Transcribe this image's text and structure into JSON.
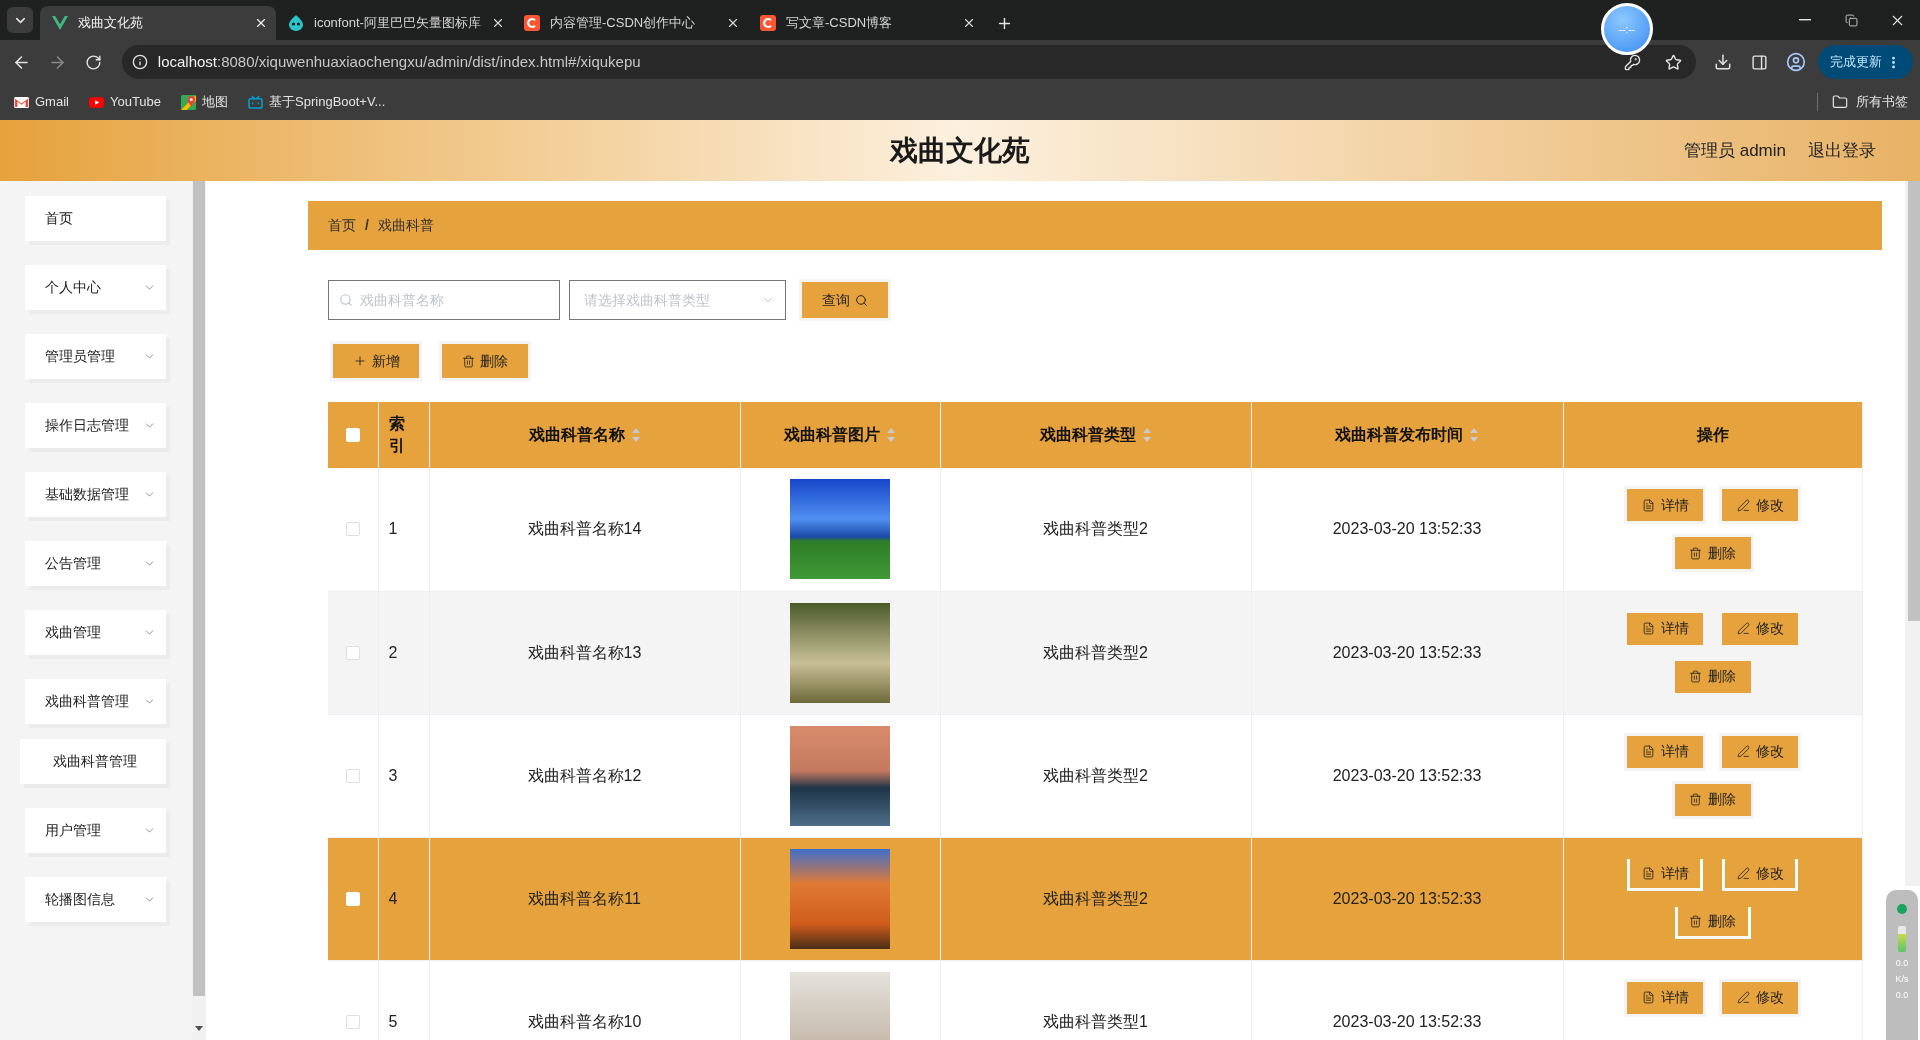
{
  "browser": {
    "tabs": [
      {
        "title": "戏曲文化苑",
        "selected": true
      },
      {
        "title": "iconfont-阿里巴巴矢量图标库",
        "selected": false
      },
      {
        "title": "内容管理-CSDN创作中心",
        "selected": false
      },
      {
        "title": "写文章-CSDN博客",
        "selected": false
      }
    ],
    "address_host": "localhost",
    "address_path": ":8080/xiquwenhuaxiaochengxu/admin/dist/index.html#/xiqukepu",
    "update_button": "完成更新",
    "bookmarks": [
      "Gmail",
      "YouTube",
      "地图",
      "基于SpringBoot+V..."
    ],
    "all_bookmarks": "所有书签"
  },
  "floating_ball": {
    "text": "--:--"
  },
  "header": {
    "title": "戏曲文化苑",
    "user": "管理员 admin",
    "logout": "退出登录"
  },
  "sidebar": {
    "items": [
      {
        "kind": "link",
        "label": "首页"
      },
      {
        "kind": "submenu",
        "label": "个人中心"
      },
      {
        "kind": "submenu",
        "label": "管理员管理"
      },
      {
        "kind": "submenu",
        "label": "操作日志管理"
      },
      {
        "kind": "submenu",
        "label": "基础数据管理"
      },
      {
        "kind": "submenu",
        "label": "公告管理"
      },
      {
        "kind": "submenu",
        "label": "戏曲管理"
      },
      {
        "kind": "submenu",
        "label": "戏曲科普管理",
        "children": [
          {
            "label": "戏曲科普管理"
          }
        ]
      },
      {
        "kind": "submenu",
        "label": "用户管理"
      },
      {
        "kind": "submenu",
        "label": "轮播图信息"
      }
    ]
  },
  "breadcrumb": {
    "items": [
      "首页",
      "戏曲科普"
    ],
    "separator": "/"
  },
  "search": {
    "name_placeholder": "戏曲科普名称",
    "type_placeholder": "请选择戏曲科普类型",
    "query_button": "查询"
  },
  "actions": [
    {
      "kind": "add",
      "label": "新增"
    },
    {
      "kind": "delete",
      "label": "删除"
    }
  ],
  "table": {
    "header_checked": false,
    "columns": [
      {
        "kind": "plain",
        "label": "索引"
      },
      {
        "kind": "sortable",
        "label": "戏曲科普名称"
      },
      {
        "kind": "sortable",
        "label": "戏曲科普图片"
      },
      {
        "kind": "sortable",
        "label": "戏曲科普类型"
      },
      {
        "kind": "sortable",
        "label": "戏曲科普发布时间"
      },
      {
        "kind": "plain",
        "label": "操作"
      }
    ],
    "rows": [
      {
        "checked": false,
        "highlighted": false,
        "index": "1",
        "name": "戏曲科普名称14",
        "type": "戏曲科普类型2",
        "time": "2023-03-20 13:52:33",
        "actions": [
          {
            "kind": "detail",
            "label": "详情"
          },
          {
            "kind": "edit",
            "label": "修改"
          },
          {
            "kind": "delete",
            "label": "删除"
          }
        ]
      },
      {
        "checked": false,
        "highlighted": false,
        "index": "2",
        "name": "戏曲科普名称13",
        "type": "戏曲科普类型2",
        "time": "2023-03-20 13:52:33",
        "actions": [
          {
            "kind": "detail",
            "label": "详情"
          },
          {
            "kind": "edit",
            "label": "修改"
          },
          {
            "kind": "delete",
            "label": "删除"
          }
        ]
      },
      {
        "checked": false,
        "highlighted": false,
        "index": "3",
        "name": "戏曲科普名称12",
        "type": "戏曲科普类型2",
        "time": "2023-03-20 13:52:33",
        "actions": [
          {
            "kind": "detail",
            "label": "详情"
          },
          {
            "kind": "edit",
            "label": "修改"
          },
          {
            "kind": "delete",
            "label": "删除"
          }
        ]
      },
      {
        "checked": false,
        "highlighted": true,
        "index": "4",
        "name": "戏曲科普名称11",
        "type": "戏曲科普类型2",
        "time": "2023-03-20 13:52:33",
        "actions": [
          {
            "kind": "detail",
            "label": "详情"
          },
          {
            "kind": "edit",
            "label": "修改"
          },
          {
            "kind": "delete",
            "label": "删除"
          }
        ]
      },
      {
        "checked": false,
        "highlighted": false,
        "index": "5",
        "name": "戏曲科普名称10",
        "type": "戏曲科普类型1",
        "time": "2023-03-20 13:52:33",
        "actions": [
          {
            "kind": "detail",
            "label": "详情"
          },
          {
            "kind": "edit",
            "label": "修改"
          }
        ]
      }
    ]
  },
  "network_widget": {
    "readings": [
      "0.0",
      "K/s",
      "0.0"
    ]
  }
}
